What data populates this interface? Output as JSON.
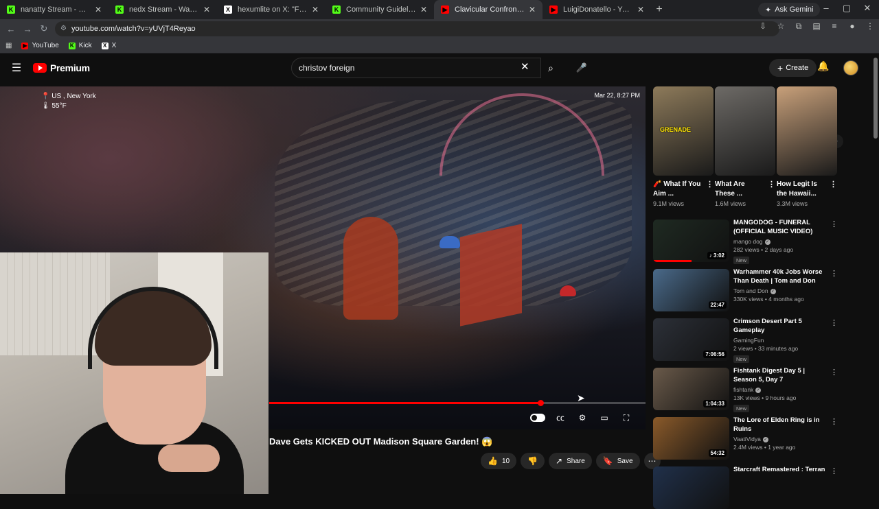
{
  "browser": {
    "tabs": [
      {
        "label": "nanatty Stream - Watch Live on Kick",
        "favicon_color": "#53fc18",
        "favicon": "K"
      },
      {
        "label": "nedx Stream - Watch Live on Kick",
        "favicon_color": "#53fc18",
        "favicon": "K"
      },
      {
        "label": "hexumlite on X: \"Full leadup and\"",
        "favicon_color": "#ffffff",
        "favicon": "X"
      },
      {
        "label": "Community Guidelines - Kick St",
        "favicon_color": "#53fc18",
        "favicon": "K"
      },
      {
        "label": "Clavicular Confronts Mom",
        "favicon_color": "#ff0000",
        "favicon": "▶",
        "active": true
      },
      {
        "label": "LuigiDonatello - YouTube",
        "favicon_color": "#ff0000",
        "favicon": "▶"
      }
    ],
    "gemini_label": "Ask Gemini",
    "url": "youtube.com/watch?v=yUVjT4Reyao",
    "bookmarks": [
      {
        "label": "YouTube",
        "color": "#ff0000",
        "icon": "▶"
      },
      {
        "label": "Kick",
        "color": "#53fc18",
        "icon": "K"
      },
      {
        "label": "X",
        "color": "#ffffff",
        "icon": "X"
      }
    ]
  },
  "youtube": {
    "brand": "Premium",
    "search_value": "christov foreign",
    "create_label": "Create",
    "accent": "#ff0000"
  },
  "video": {
    "location": "US , New York",
    "temperature": "55°F",
    "timestamp": "Mar 22, 8:27 PM",
    "progress": 0.72,
    "title": "Dave Gets KICKED OUT Madison Square Garden! 😱",
    "likes": "10",
    "share_label": "Share",
    "save_label": "Save"
  },
  "shorts": [
    {
      "title": "🧨 What If You Aim ...",
      "views": "9.1M views",
      "thumb_color": "#8d7a5a",
      "overlay": "GRENADE"
    },
    {
      "title": "What Are These ...",
      "views": "1.6M views",
      "thumb_color": "#6d6a66",
      "overlay": ""
    },
    {
      "title": "How Legit Is the Hawaii...",
      "views": "3.3M views",
      "thumb_color": "#c8a07a",
      "overlay": ""
    }
  ],
  "recommendations": [
    {
      "title": "MANGODOG - FUNERAL (OFFICIAL MUSIC VIDEO)",
      "channel": "mango dog",
      "verified": true,
      "meta": "282 views • 2 days ago",
      "badge": "New",
      "duration": "♪ 3:02",
      "thumb_color": "#1f2a22",
      "watched": 0.5
    },
    {
      "title": "Warhammer 40k Jobs Worse Than Death | Tom and Don",
      "channel": "Tom and Don",
      "verified": true,
      "meta": "330K views • 4 months ago",
      "badge": "",
      "duration": "22:47",
      "thumb_color": "#4a6a8a",
      "watched": 0
    },
    {
      "title": "Crimson Desert Part 5 Gameplay",
      "channel": "GamingFun",
      "verified": false,
      "meta": "2 views • 33 minutes ago",
      "badge": "New",
      "duration": "7:06:56",
      "thumb_color": "#2c3038",
      "watched": 0
    },
    {
      "title": "Fishtank Digest Day 5 | Season 5, Day 7",
      "channel": "fishtank",
      "verified": true,
      "meta": "13K views • 9 hours ago",
      "badge": "New",
      "duration": "1:04:33",
      "thumb_color": "#6a5a4a",
      "watched": 0
    },
    {
      "title": "The Lore of Elden Ring is in Ruins",
      "channel": "VaatiVidya",
      "verified": true,
      "meta": "2.4M views • 1 year ago",
      "badge": "",
      "duration": "54:32",
      "thumb_color": "#8a5a2a",
      "watched": 0
    },
    {
      "title": "Starcraft Remastered : Terran",
      "channel": "",
      "verified": false,
      "meta": "",
      "badge": "",
      "duration": "",
      "thumb_color": "#20304a",
      "watched": 0
    }
  ]
}
